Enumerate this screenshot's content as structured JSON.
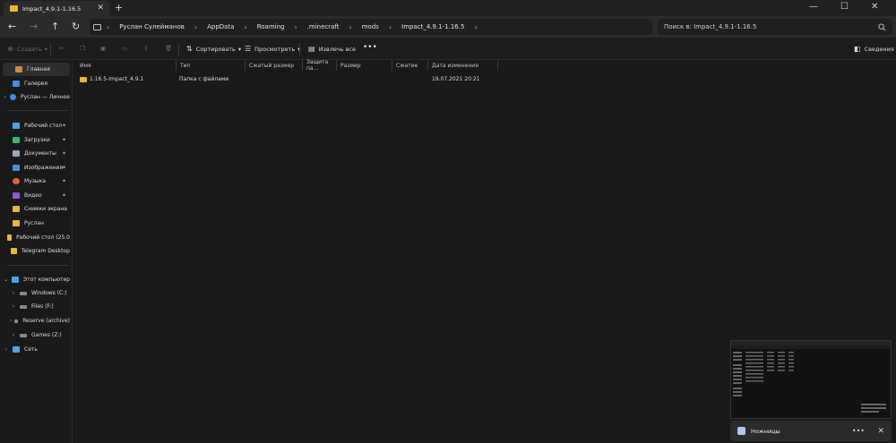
{
  "window": {
    "tab_title": "Impact_4.9.1-1.16.5",
    "new_tab": "+",
    "minimize": "—",
    "maximize": "☐",
    "close": "✕",
    "tab_close": "✕"
  },
  "nav": {
    "back": "←",
    "forward": "→",
    "up": "↑",
    "refresh": "↻"
  },
  "breadcrumbs": [
    "Руслан Сулейманов",
    "AppData",
    "Roaming",
    ".minecraft",
    "mods",
    "Impact_4.9.1-1.16.5"
  ],
  "crumb_sep": "›",
  "search": {
    "placeholder": "Поиск в: Impact_4.9.1-1.16.5"
  },
  "toolbar": {
    "create": "Создать",
    "sort": "Сортировать",
    "view": "Просмотреть",
    "extract": "Извлечь все",
    "more": "•••",
    "details": "Сведения"
  },
  "sidebar": {
    "items": [
      {
        "label": "Главная",
        "icon": "home-icon",
        "selected": true
      },
      {
        "label": "Галерея",
        "icon": "gallery-icon"
      },
      {
        "label": "Руслан — Личное",
        "icon": "cloud-icon",
        "chevron": true
      },
      {
        "label": "Рабочий стол",
        "icon": "desktop-icon",
        "pinned": true
      },
      {
        "label": "Загрузки",
        "icon": "downloads-icon",
        "pinned": true
      },
      {
        "label": "Документы",
        "icon": "documents-icon",
        "pinned": true
      },
      {
        "label": "Изображения",
        "icon": "pictures-icon",
        "pinned": true
      },
      {
        "label": "Музыка",
        "icon": "music-icon",
        "pinned": true
      },
      {
        "label": "Видео",
        "icon": "video-icon",
        "pinned": true
      },
      {
        "label": "Снимки экрана",
        "icon": "folder-icon"
      },
      {
        "label": "Руслан",
        "icon": "folder-icon"
      },
      {
        "label": "Рабочий стол (25.0",
        "icon": "folder-icon"
      },
      {
        "label": "Telegram Desktop",
        "icon": "folder-icon"
      },
      {
        "label": "Этот компьютер",
        "icon": "computer-icon",
        "expanded": true
      },
      {
        "label": "Windows (C:)",
        "icon": "drive-icon",
        "chevron": true
      },
      {
        "label": "Files (F:)",
        "icon": "drive-icon",
        "chevron": true
      },
      {
        "label": "Reserve (archive)",
        "icon": "drive-icon",
        "chevron": true
      },
      {
        "label": "Games (Z:)",
        "icon": "drive-icon",
        "chevron": true
      },
      {
        "label": "Сеть",
        "icon": "network-icon",
        "chevron": true
      }
    ]
  },
  "columns": [
    "Имя",
    "Тип",
    "Сжатый размер",
    "Защита па...",
    "Размер",
    "Сжатие",
    "Дата изменения"
  ],
  "rows": [
    {
      "name": "1.16.5-Impact_4.9.1",
      "type": "Папка с файлами",
      "date": "19.07.2021 20:21"
    }
  ],
  "toast": {
    "title": "Ножницы",
    "more": "•••",
    "close": "✕"
  },
  "colors": {
    "folder": "#e8b53a",
    "accent": "#4aa3ff"
  }
}
